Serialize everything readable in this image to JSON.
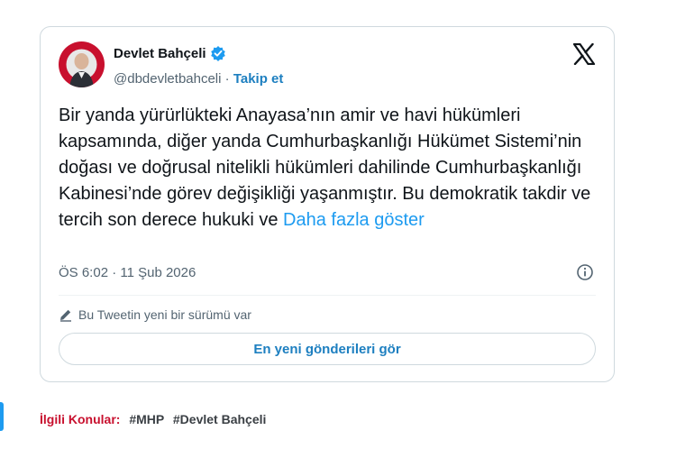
{
  "tweet": {
    "author_name": "Devlet Bahçeli",
    "handle": "@dbdevletbahceli",
    "separator": "·",
    "follow_label": "Takip et",
    "text": "Bir yanda yürürlükteki Anayasa’nın amir ve havi hükümleri kapsamında, diğer yanda Cumhurbaşkanlığı Hükümet Sistemi’nin doğası ve doğrusal nitelikli hükümleri dahilinde Cumhurbaşkanlığı Kabinesi’nde görev değişikliği yaşanmıştır. Bu demokratik takdir ve tercih son derece hukuki ve",
    "show_more": "Daha fazla göster",
    "timestamp": "ÖS 6:02 · 11 Şub 2026",
    "version_notice": "Bu Tweetin yeni bir sürümü var",
    "latest_button": "En yeni gönderileri gör"
  },
  "icons": {
    "verified": "verified-badge-icon",
    "x_logo": "x-logo-icon",
    "info": "info-icon",
    "pencil": "pencil-icon"
  },
  "topics": {
    "label": "İlgili Konular:",
    "tags": [
      "#MHP",
      "#Devlet Bahçeli"
    ]
  },
  "colors": {
    "accent": "#1d9bf0",
    "link": "#1d7fc0",
    "topics_label": "#c8102e",
    "border": "#cfd9de"
  }
}
